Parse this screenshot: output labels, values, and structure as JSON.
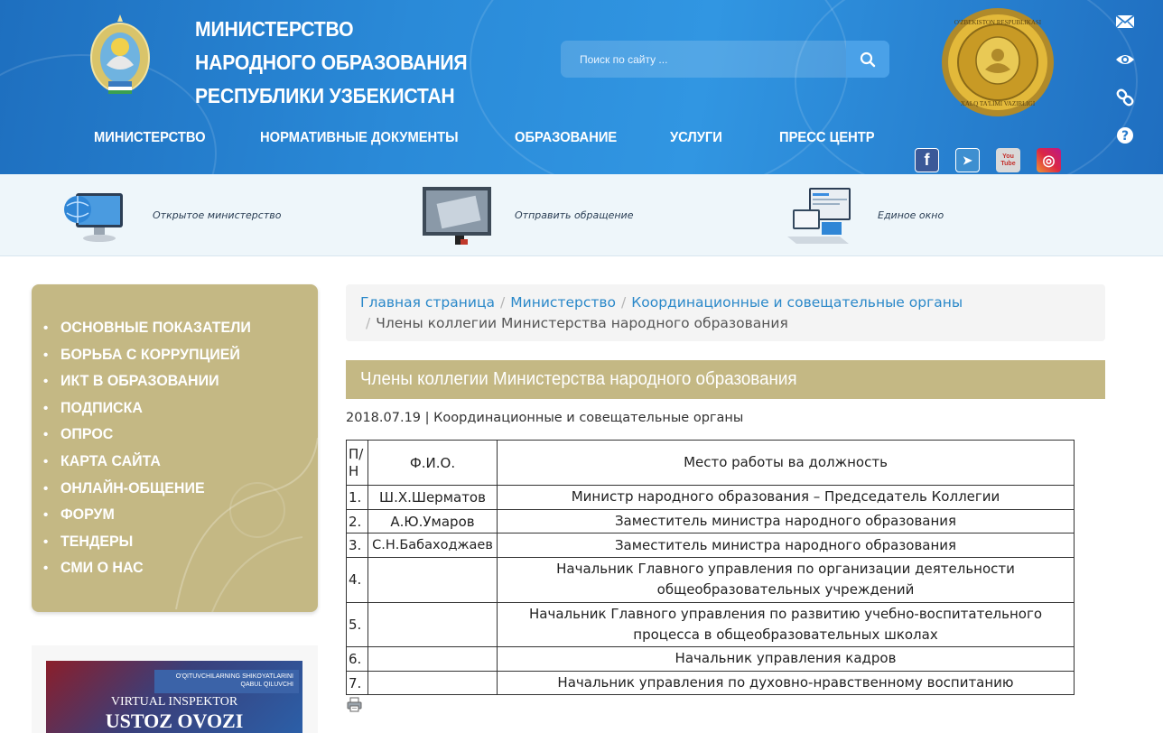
{
  "colors": {
    "header_blue": "#2a8ad8",
    "gold_panel": "#c4b884",
    "link_blue": "#2a88c9",
    "breadcrumb_bg": "#f4f4f4",
    "services_bg": "#eef6fa"
  },
  "header": {
    "title_lines": [
      "МИНИСТЕРСТВО",
      "НАРОДНОГО ОБРАЗОВАНИЯ",
      "РЕСПУБЛИКИ УЗБЕКИСТАН"
    ],
    "search_placeholder": "Поиск по сайту ...",
    "search_icon": "search-icon",
    "seal_text_top": "O'ZBEKISTON RESPUBLIKASI",
    "seal_text_bottom": "XALQ TA'LIMI VAZIRLIGI",
    "nav": [
      "МИНИСТЕРСТВО",
      "НОРМАТИВНЫЕ ДОКУМЕНТЫ",
      "ОБРАЗОВАНИЕ",
      "УСЛУГИ",
      "ПРЕСС ЦЕНТР"
    ],
    "side_tools": [
      "mail-icon",
      "eye-icon",
      "link-icon",
      "help-icon"
    ],
    "socials": [
      {
        "name": "facebook-icon",
        "glyph": "f"
      },
      {
        "name": "telegram-icon",
        "glyph": "➤"
      },
      {
        "name": "youtube-icon",
        "glyph": "You Tube"
      },
      {
        "name": "instagram-icon",
        "glyph": "◎"
      }
    ]
  },
  "services": [
    {
      "label": "Открытое министерство",
      "icon": "monitor-globe-icon"
    },
    {
      "label": "Отправить обращение",
      "icon": "monitor-mail-icon"
    },
    {
      "label": "Единое окно",
      "icon": "single-window-icon"
    }
  ],
  "sidebar": {
    "items": [
      "ОСНОВНЫЕ ПОКАЗАТЕЛИ",
      "БОРЬБА С КОРРУПЦИЕЙ",
      "ИКТ В ОБРАЗОВАНИИ",
      "ПОДПИСКА",
      "ОПРОС",
      "КАРТА САЙТА",
      "ОНЛАЙН-ОБЩЕНИЕ",
      "ФОРУМ",
      "ТЕНДЕРЫ",
      "СМИ О НАС"
    ],
    "banner": {
      "top": "O'QITUVCHILARNING SHIKOYATLARINI QABUL QILUVCHI",
      "mid": "VIRTUAL INSPEKTOR",
      "big": "USTOZ OVOZI"
    }
  },
  "breadcrumb": {
    "items": [
      "Главная страница",
      "Министерство",
      "Координационные и совещательные органы"
    ],
    "current": "Члены коллегии Министерства народного образования"
  },
  "article": {
    "title": "Члены коллегии Министерства народного образования",
    "date": "2018.07.19",
    "category": "Координационные и совещательные органы",
    "meta_separator": " | "
  },
  "table": {
    "headers": {
      "num": "П/Н",
      "name": "Ф.И.О.",
      "position": "Место работы ва должность"
    },
    "rows": [
      {
        "num": "1.",
        "name": "Ш.Х.Шерматов",
        "position": "Министр народного образования – Председатель Коллегии"
      },
      {
        "num": "2.",
        "name": "А.Ю.Умаров",
        "position": "Заместитель министра народного образования"
      },
      {
        "num": "3.",
        "name": "С.Н.Бабаходжаев",
        "position": "Заместитель министра народного образования"
      },
      {
        "num": "4.",
        "name": "",
        "position": "Начальник Главного управления по организации деятельности общеобразовательных учреждений"
      },
      {
        "num": "5.",
        "name": "",
        "position": "Начальник Главного управления по развитию учебно-воспитательного процесса в общеобразовательных школах"
      },
      {
        "num": "6.",
        "name": "",
        "position": "Начальник управления кадров"
      },
      {
        "num": "7.",
        "name": "",
        "position": "Начальник управления по духовно-нравственному воспитанию"
      }
    ]
  },
  "print_icon": "print-icon"
}
